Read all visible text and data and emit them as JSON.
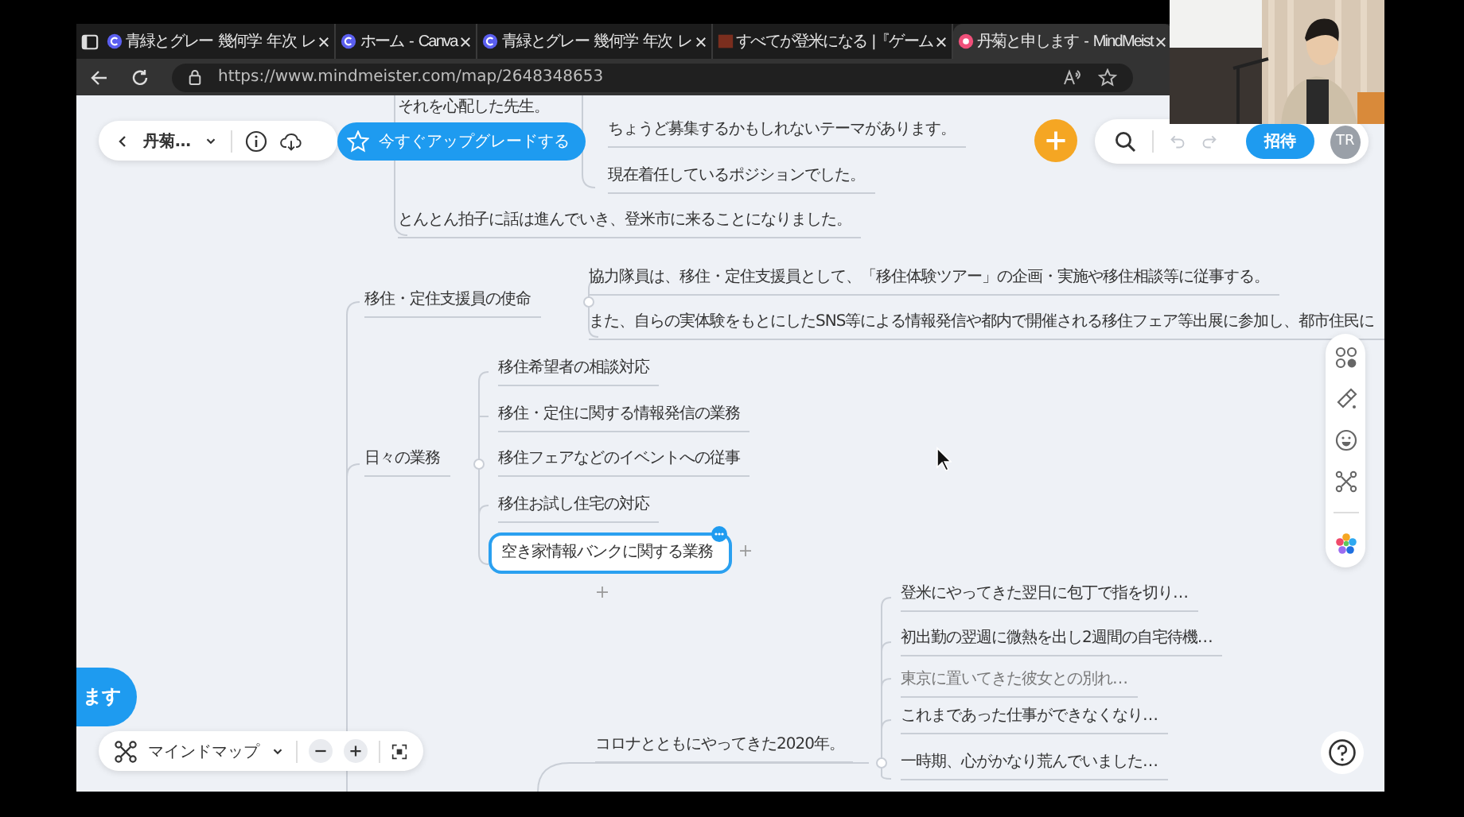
{
  "browser": {
    "tabs": [
      {
        "title": "青緑とグレー 幾何学 年次 レ",
        "kind": "canva",
        "selected": false
      },
      {
        "title": "ホーム - Canva",
        "kind": "canva",
        "selected": false
      },
      {
        "title": "青緑とグレー 幾何学 年次 レ",
        "kind": "canva",
        "selected": false
      },
      {
        "title": "すべてが登米になる |『ゲーム",
        "kind": "gm",
        "selected": false
      },
      {
        "title": "丹菊と申します - MindMeist",
        "kind": "mindmeister",
        "selected": true
      }
    ],
    "address": "https://www.mindmeister.com/map/2648348653"
  },
  "toolbar": {
    "map_title": "丹菊…",
    "upgrade_button": "今すぐアップグレードする",
    "can_undo": false,
    "can_redo": false,
    "invite_button": "招待",
    "avatar": "TR"
  },
  "nodes": [
    {
      "text": "それを心配した先生。",
      "kind": "topic",
      "selected": false
    },
    {
      "text": "ちょうど募集するかもしれないテーマがあります。",
      "kind": "topic",
      "selected": false
    },
    {
      "text": "現在着任しているポジションでした。",
      "kind": "topic",
      "selected": false
    },
    {
      "text": "とんとん拍子に話は進んでいき、登米市に来ることになりました。",
      "kind": "topic",
      "selected": false
    },
    {
      "text": "移住・定住支援員の使命",
      "kind": "topic",
      "selected": false
    },
    {
      "text": "協力隊員は、移住・定住支援員として、「移住体験ツアー」の企画・実施や移住相談等に従事する。",
      "kind": "topic",
      "selected": false
    },
    {
      "text": "また、自らの実体験をもとにしたSNS等による情報発信や都内で開催される移住フェア等出展に参加し、都市住民に",
      "kind": "topic",
      "selected": false
    },
    {
      "text": "日々の業務",
      "kind": "topic",
      "selected": false
    },
    {
      "text": "移住希望者の相談対応",
      "kind": "topic",
      "selected": false
    },
    {
      "text": "移住・定住に関する情報発信の業務",
      "kind": "topic",
      "selected": false
    },
    {
      "text": "移住フェアなどのイベントへの従事",
      "kind": "topic",
      "selected": false
    },
    {
      "text": "移住お試し住宅の対応",
      "kind": "topic",
      "selected": false
    },
    {
      "text": "空き家情報バンクに関する業務",
      "kind": "topic",
      "selected": true
    },
    {
      "text": "コロナとともにやってきた2020年。",
      "kind": "topic",
      "selected": false
    },
    {
      "text": "登米にやってきた翌日に包丁で指を切り…",
      "kind": "topic",
      "selected": false
    },
    {
      "text": "初出勤の翌週に微熱を出し2週間の自宅待機…",
      "kind": "topic",
      "selected": false
    },
    {
      "text": "東京に置いてきた彼女との別れ…",
      "kind": "note",
      "selected": false
    },
    {
      "text": "これまであった仕事ができなくなり…",
      "kind": "topic",
      "selected": false
    },
    {
      "text": "一時期、心がかなり荒んでいました…",
      "kind": "topic",
      "selected": false
    }
  ],
  "side_bubble": "ます",
  "bottom_bar": {
    "view_mode": "マインドマップ"
  }
}
